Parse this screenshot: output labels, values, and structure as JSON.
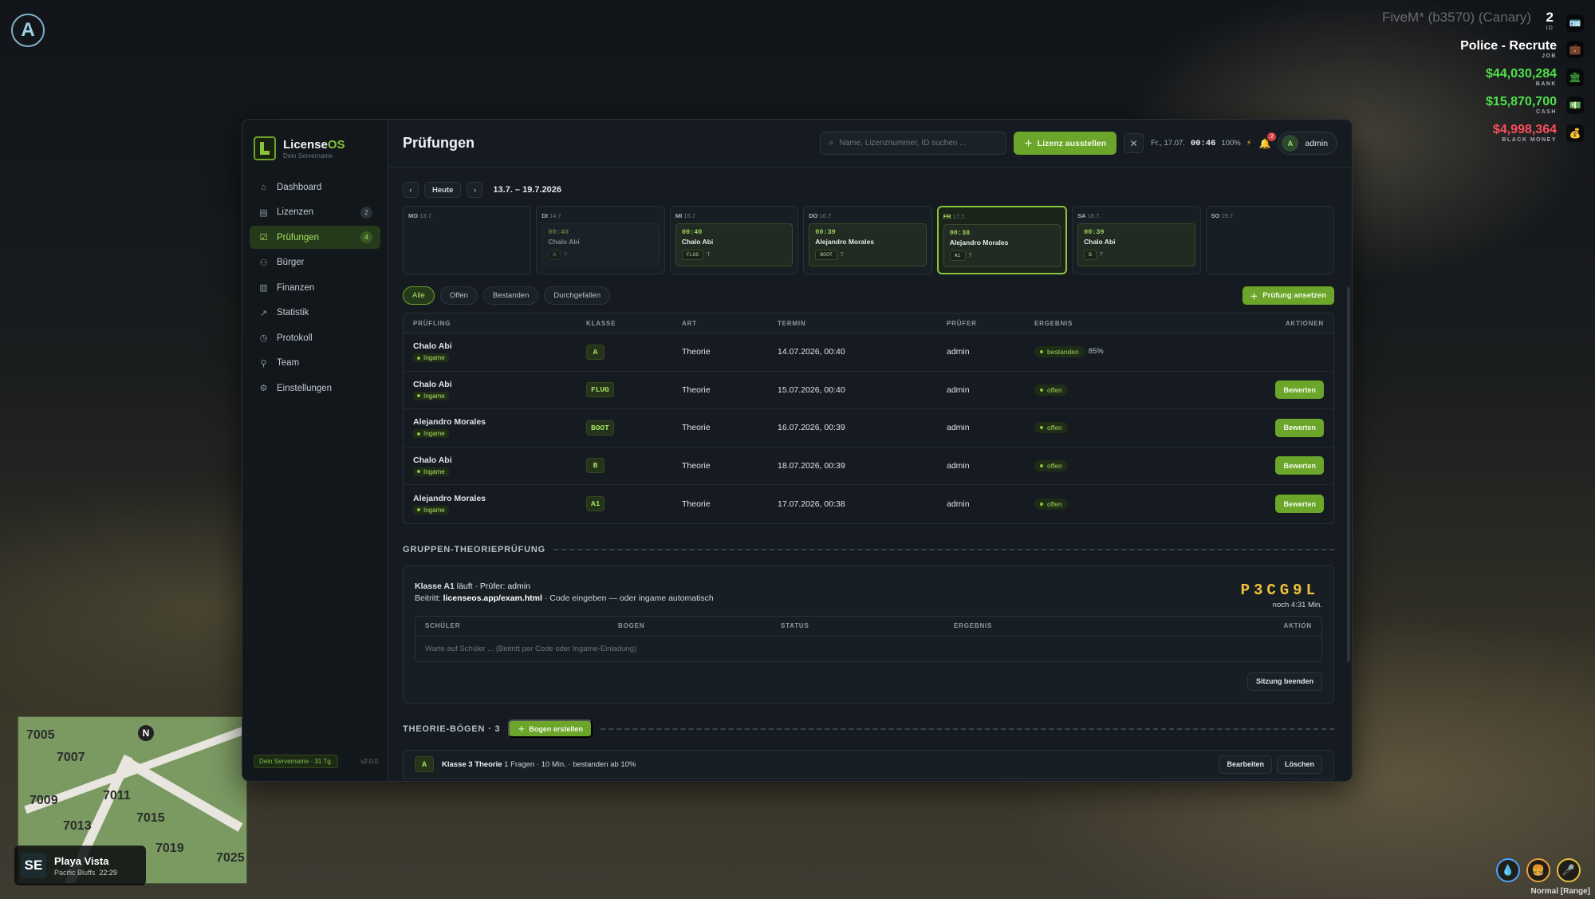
{
  "hud": {
    "logo_letter": "A",
    "build": "FiveM* (b3570) (Canary)",
    "player_id": "2",
    "player_id_label": "ID",
    "job": "Police - Recrute",
    "job_label": "JOB",
    "bank": "$44,030,284",
    "bank_label": "BANK",
    "cash": "$15,870,700",
    "cash_label": "CASH",
    "black_money": "$4,998,364",
    "black_money_label": "BLACK MONEY",
    "voice_mode": "Normal [Range]",
    "colors": {
      "bank": "#4fe04a",
      "cash": "#4fe04a",
      "black_money": "#ff4d5e"
    }
  },
  "minimap": {
    "north": "N",
    "numbers": [
      "7005",
      "7007",
      "7011",
      "7015",
      "7013",
      "7019",
      "7025",
      "7009"
    ]
  },
  "location": {
    "direction": "SE",
    "street": "Playa Vista",
    "area": "Pacific Bluffs",
    "time": "22:29"
  },
  "app": {
    "brand_name": "License",
    "brand_name_suffix": "OS",
    "brand_sub": "Dein Servername",
    "accent": "#6ba52a",
    "nav": [
      {
        "label": "Dashboard",
        "icon": "home-icon",
        "badge": ""
      },
      {
        "label": "Lizenzen",
        "icon": "id-card-icon",
        "badge": "2"
      },
      {
        "label": "Prüfungen",
        "icon": "clipboard-check-icon",
        "badge": "4",
        "active": true
      },
      {
        "label": "Bürger",
        "icon": "users-icon",
        "badge": ""
      },
      {
        "label": "Finanzen",
        "icon": "bar-chart-icon",
        "badge": ""
      },
      {
        "label": "Statistik",
        "icon": "line-chart-icon",
        "badge": ""
      },
      {
        "label": "Protokoll",
        "icon": "clock-icon",
        "badge": ""
      },
      {
        "label": "Team",
        "icon": "user-icon",
        "badge": ""
      },
      {
        "label": "Einstellungen",
        "icon": "gear-icon",
        "badge": ""
      }
    ],
    "server_tag": "Dein Servername · 31 Tg.",
    "version": "v2.0.0"
  },
  "topbar": {
    "title": "Prüfungen",
    "search_placeholder": "Name, Lizenznummer, ID suchen ...",
    "issue_label": "Lizenz ausstellen",
    "date": "Fr., 17.07.",
    "time": "00:46",
    "battery": "100%",
    "notifications": "2",
    "user": "admin",
    "user_initial": "A"
  },
  "week": {
    "today_label": "Heute",
    "range": "13.7. – 19.7.2026",
    "days": [
      {
        "abbr": "MO",
        "date": "13.7.",
        "event": null
      },
      {
        "abbr": "DI",
        "date": "14.7.",
        "event": {
          "time": "00:40",
          "name": "Chalo Abi",
          "cls": "A",
          "art": "T",
          "past": true
        }
      },
      {
        "abbr": "MI",
        "date": "15.7.",
        "event": {
          "time": "00:40",
          "name": "Chalo Abi",
          "cls": "FLUG",
          "art": "T",
          "past": false
        }
      },
      {
        "abbr": "DO",
        "date": "16.7.",
        "event": {
          "time": "00:39",
          "name": "Alejandro Morales",
          "cls": "BOOT",
          "art": "T",
          "past": false
        }
      },
      {
        "abbr": "FR",
        "date": "17.7.",
        "today": true,
        "event": {
          "time": "00:38",
          "name": "Alejandro Morales",
          "cls": "A1",
          "art": "T",
          "past": false
        }
      },
      {
        "abbr": "SA",
        "date": "18.7.",
        "event": {
          "time": "00:39",
          "name": "Chalo Abi",
          "cls": "B",
          "art": "T",
          "past": false
        }
      },
      {
        "abbr": "SO",
        "date": "19.7.",
        "event": null
      }
    ]
  },
  "filters": [
    "Alle",
    "Offen",
    "Bestanden",
    "Durchgefallen"
  ],
  "schedule_label": "Prüfung ansetzen",
  "table": {
    "headers": [
      "PRÜFLING",
      "KLASSE",
      "ART",
      "TERMIN",
      "PRÜFER",
      "ERGEBNIS",
      "AKTIONEN"
    ],
    "ingame_label": "Ingame",
    "rate_label": "Bewerten",
    "rows": [
      {
        "name": "Chalo Abi",
        "cls": "A",
        "art": "Theorie",
        "termin": "14.07.2026, 00:40",
        "pruefer": "admin",
        "status": "bestanden",
        "score": "85%",
        "action": ""
      },
      {
        "name": "Chalo Abi",
        "cls": "FLUG",
        "art": "Theorie",
        "termin": "15.07.2026, 00:40",
        "pruefer": "admin",
        "status": "offen",
        "score": "",
        "action": "Bewerten"
      },
      {
        "name": "Alejandro Morales",
        "cls": "BOOT",
        "art": "Theorie",
        "termin": "16.07.2026, 00:39",
        "pruefer": "admin",
        "status": "offen",
        "score": "",
        "action": "Bewerten"
      },
      {
        "name": "Chalo Abi",
        "cls": "B",
        "art": "Theorie",
        "termin": "18.07.2026, 00:39",
        "pruefer": "admin",
        "status": "offen",
        "score": "",
        "action": "Bewerten"
      },
      {
        "name": "Alejandro Morales",
        "cls": "A1",
        "art": "Theorie",
        "termin": "17.07.2026, 00:38",
        "pruefer": "admin",
        "status": "offen",
        "score": "",
        "action": "Bewerten"
      }
    ]
  },
  "group": {
    "title": "GRUPPEN-THEORIEPRÜFUNG",
    "class_label": "Klasse A1",
    "running": " läuft · Prüfer: admin",
    "join_prefix": "Beitritt: ",
    "join_url": "licenseos.app/exam.html",
    "join_suffix": " · Code eingeben — oder ingame automatisch",
    "code": "P3CG9L",
    "remaining": "noch 4:31 Min.",
    "headers": [
      "SCHÜLER",
      "BOGEN",
      "STATUS",
      "ERGEBNIS",
      "AKTION"
    ],
    "empty": "Warte auf Schüler ... (Beitritt per Code oder Ingame-Einladung)",
    "end_label": "Sitzung beenden"
  },
  "sheets": {
    "title": "THEORIE-BÖGEN · 3",
    "create_label": "Bogen erstellen",
    "items": [
      {
        "cls": "A",
        "name": "Klasse 3 Theorie",
        "meta": " 1 Fragen · 10 Min. · bestanden ab 10%",
        "edit": "Bearbeiten",
        "delete": "Löschen"
      }
    ]
  }
}
